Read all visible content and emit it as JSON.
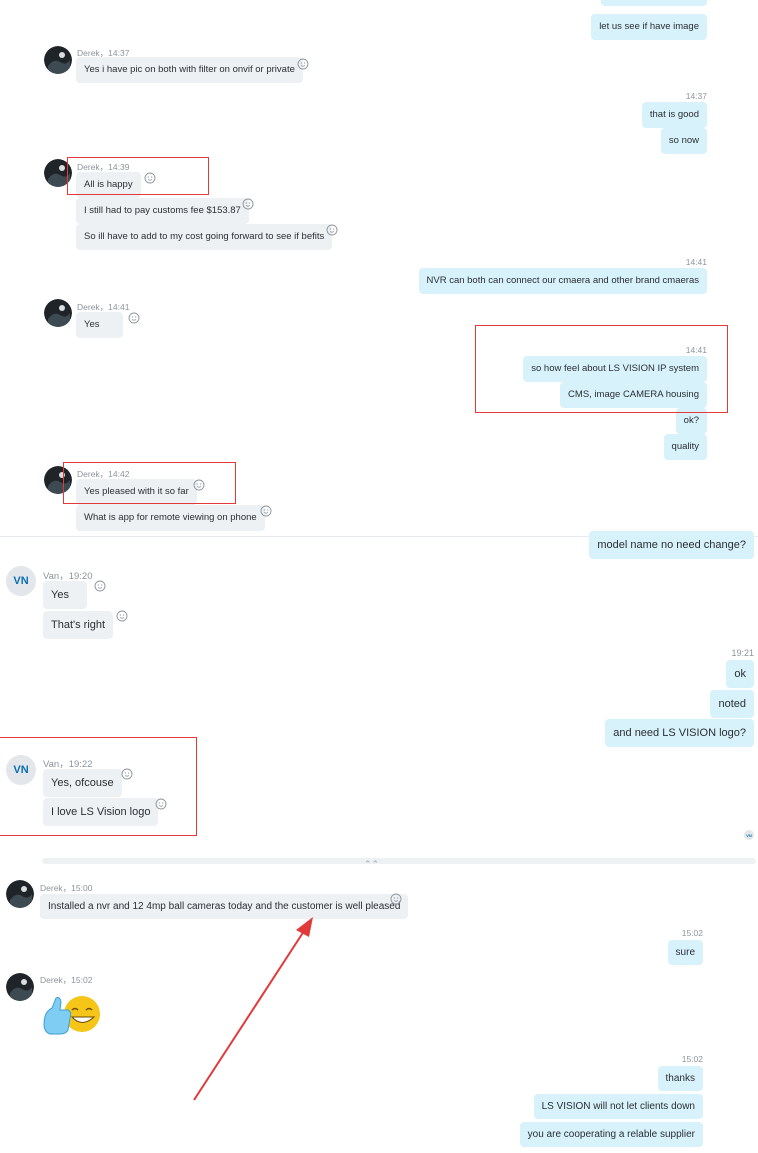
{
  "chat1": {
    "top_partial": "let us see if have image",
    "derek1": {
      "meta": "Derek，14:37",
      "msg": "Yes i have pic on both with filter on onvif or private"
    },
    "me1": {
      "time": "14:37",
      "msgs": [
        "that is good",
        "so now"
      ]
    },
    "derek2": {
      "meta": "Derek，14:39",
      "msgs": [
        "All is happy",
        "I still had to pay customs fee $153.87",
        "So ill have to add to my cost going forward to see if befits"
      ]
    },
    "me2": {
      "time": "14:41",
      "msg": "NVR can both can connect our cmaera and other brand cmaeras"
    },
    "derek3": {
      "meta": "Derek，14:41",
      "msg": "Yes"
    },
    "me3": {
      "time": "14:41",
      "msgs": [
        "so how feel about LS VISION IP system",
        "CMS, image CAMERA housing",
        "ok?",
        "quality"
      ]
    },
    "derek4": {
      "meta": "Derek，14:42",
      "msgs": [
        "Yes pleased with it so far",
        "What is app for remote viewing on phone"
      ]
    }
  },
  "chat2": {
    "top_out": "model name no need change?",
    "van1": {
      "avatar": "VN",
      "meta": "Van，19:20",
      "msgs": [
        "Yes",
        "That's right"
      ]
    },
    "me1": {
      "time": "19:21",
      "msgs": [
        "ok",
        "noted",
        "and need LS VISION logo?"
      ]
    },
    "van2": {
      "avatar": "VN",
      "meta": "Van，19:22",
      "msgs": [
        "Yes, ofcouse",
        "I love LS Vision logo"
      ]
    },
    "read_receipt": "VN"
  },
  "chat3": {
    "derek1": {
      "meta": "Derek，15:00",
      "msg": "Installed a nvr and 12 4mp ball cameras today and the customer is well pleased"
    },
    "me1": {
      "time": "15:02",
      "msg": "sure"
    },
    "derek2": {
      "meta": "Derek，15:02",
      "emoji": "thumbs-up-grin"
    },
    "me2": {
      "time": "15:02",
      "msgs": [
        "thanks",
        "LS VISION will not let clients down",
        "you are cooperating a relable supplier"
      ]
    }
  },
  "colors": {
    "incoming_bubble": "#eef1f4",
    "outgoing_bubble": "#d8f2fb",
    "annotation_red": "#e23a3a",
    "avatar_initials": "#0a6fb3"
  }
}
